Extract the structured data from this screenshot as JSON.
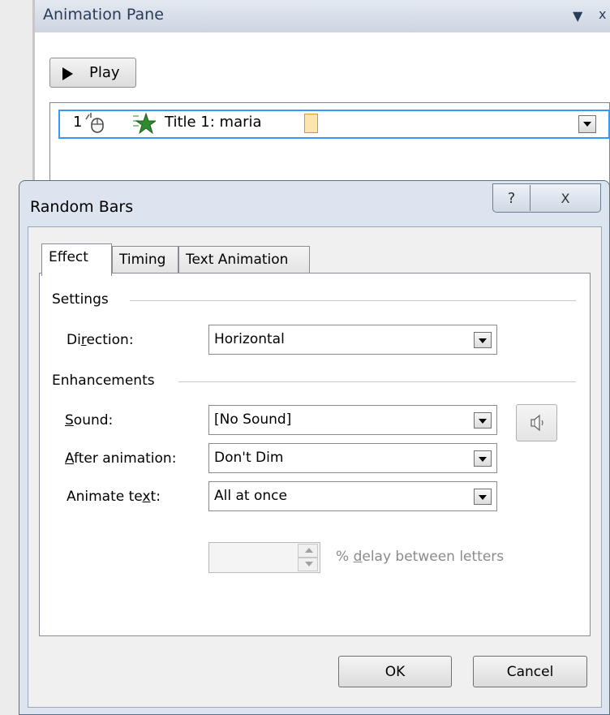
{
  "animation_pane": {
    "title": "Animation Pane",
    "dropdown_glyph": "▼",
    "close_glyph": "x",
    "play_label": "Play",
    "items": [
      {
        "number": "1",
        "trigger_icon": "mouse-click-icon",
        "effect_icon": "green-star-icon",
        "label": "Title 1: maria",
        "timing_color": "#fde6ad"
      }
    ]
  },
  "dialog": {
    "title": "Random Bars",
    "help_glyph": "?",
    "close_glyph": "X",
    "tabs": [
      {
        "label": "Effect",
        "active": true
      },
      {
        "label": "Timing",
        "active": false
      },
      {
        "label": "Text Animation",
        "active": false
      }
    ],
    "settings": {
      "group_label": "Settings",
      "direction_label_before": "Di",
      "direction_label_u": "r",
      "direction_label_after": "ection:",
      "direction_value": "Horizontal"
    },
    "enhancements": {
      "group_label": "Enhancements",
      "sound_label_u": "S",
      "sound_label_after": "ound:",
      "sound_value": "[No Sound]",
      "after_label_u": "A",
      "after_label_after": "fter animation:",
      "after_value": "Don't Dim",
      "animate_label_before": "Animate te",
      "animate_label_u": "x",
      "animate_label_after": "t:",
      "animate_value": "All at once",
      "delay_value": "",
      "delay_label_before": "% ",
      "delay_label_u": "d",
      "delay_label_after": "elay between letters"
    },
    "ok_label": "OK",
    "cancel_label": "Cancel"
  }
}
